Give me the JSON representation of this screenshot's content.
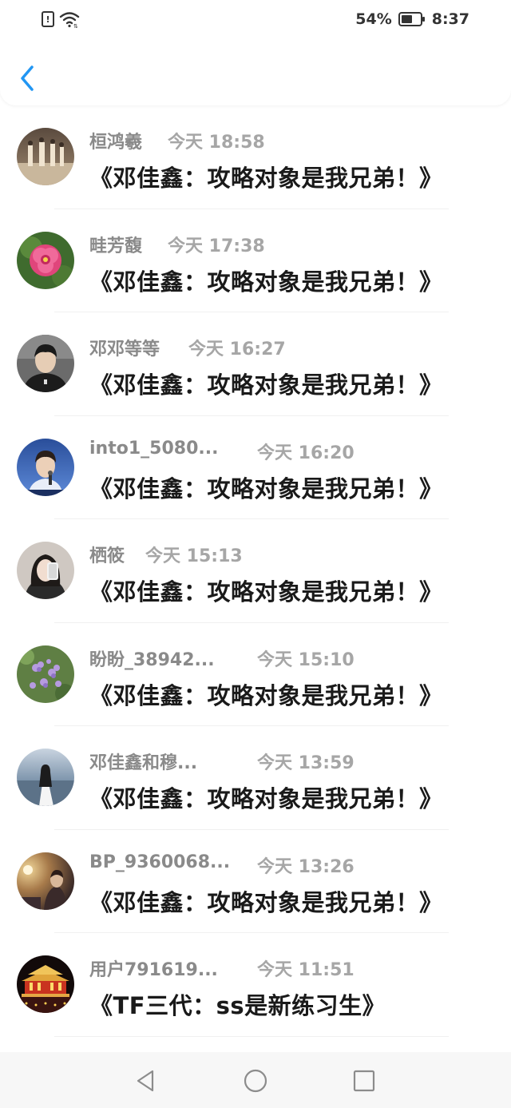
{
  "status_bar": {
    "battery_percent": "54%",
    "time": "8:37",
    "sim_alert_glyph": "!"
  },
  "icons": {
    "back": "chevron-left-icon",
    "sim": "sim-card-alert-icon",
    "wifi": "wifi-icon",
    "battery": "battery-icon",
    "nav_back": "triangle-back-icon",
    "nav_home": "circle-home-icon",
    "nav_recent": "square-recent-icon"
  },
  "colors": {
    "accent": "#2196f3",
    "name_text": "#8a8a8a",
    "time_text": "#a6a6a6",
    "title_text": "#1a1a1a"
  },
  "messages": [
    {
      "name": "桓鸿羲",
      "time": "今天 18:58",
      "title": "《邓佳鑫：攻略对象是我兄弟！》",
      "avatar": "people-dancing-avatar"
    },
    {
      "name": "畦芳馥",
      "time": "今天 17:38",
      "title": "《邓佳鑫：攻略对象是我兄弟！》",
      "avatar": "pink-flower-avatar"
    },
    {
      "name": "邓邓等等",
      "time": "今天 16:27",
      "title": "《邓佳鑫：攻略对象是我兄弟！》",
      "avatar": "young-man-portrait-avatar"
    },
    {
      "name": "into1_5080...",
      "time": "今天 16:20",
      "title": "《邓佳鑫：攻略对象是我兄弟！》",
      "avatar": "singer-on-stage-avatar"
    },
    {
      "name": "栖筱",
      "time": "今天 15:13",
      "title": "《邓佳鑫：攻略对象是我兄弟！》",
      "avatar": "girl-selfie-avatar"
    },
    {
      "name": "盼盼_38942...",
      "time": "今天 15:10",
      "title": "《邓佳鑫：攻略对象是我兄弟！》",
      "avatar": "purple-flowers-avatar"
    },
    {
      "name": "邓佳鑫和穆...",
      "time": "今天 13:59",
      "title": "《邓佳鑫：攻略对象是我兄弟！》",
      "avatar": "girl-at-beach-avatar"
    },
    {
      "name": "BP_9360068...",
      "time": "今天 13:26",
      "title": "《邓佳鑫：攻略对象是我兄弟！》",
      "avatar": "stage-performance-avatar"
    },
    {
      "name": "用户791619...",
      "time": "今天 11:51",
      "title": "《TF三代：ss是新练习生》",
      "avatar": "palace-night-avatar"
    }
  ]
}
